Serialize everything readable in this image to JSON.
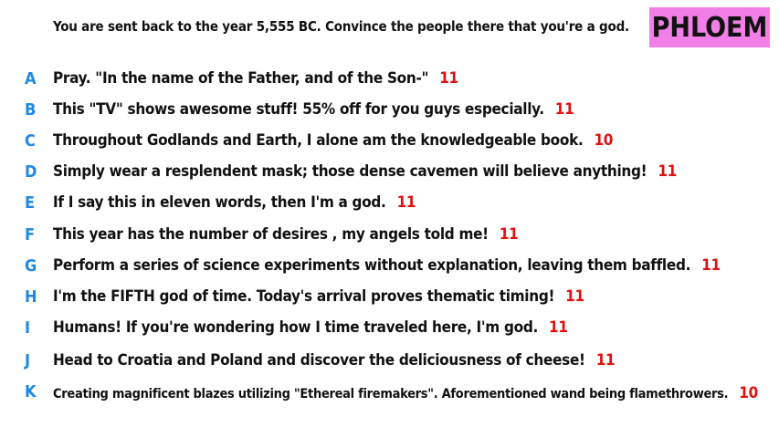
{
  "prompt": "You are sent back to the year 5,555 BC. Convince the people there that you're a god.",
  "logo": "PHLOEM",
  "answers": [
    {
      "letter": "A",
      "text": "Pray. \"In the name of the Father, and of the Son-\"",
      "score": "11"
    },
    {
      "letter": "B",
      "text": "This \"TV\" shows awesome stuff! 55% off for you guys especially.",
      "score": "11"
    },
    {
      "letter": "C",
      "text": "Throughout Godlands and Earth, I alone am the knowledgeable book.",
      "score": "10"
    },
    {
      "letter": "D",
      "text": "Simply wear a resplendent mask; those dense cavemen will believe anything!",
      "score": "11"
    },
    {
      "letter": "E",
      "text": "If I say this in eleven words, then I'm a god.",
      "score": "11"
    },
    {
      "letter": "F",
      "text": "This year has the number of desires , my angels told me!",
      "score": "11"
    },
    {
      "letter": "G",
      "text": "Perform a series of science experiments without explanation, leaving them baffled.",
      "score": "11"
    },
    {
      "letter": "H",
      "text": "I'm the FIFTH god of time. Today's arrival proves thematic timing!",
      "score": "11"
    },
    {
      "letter": "I",
      "text": "Humans! If you're wondering how I time traveled here, I'm god.",
      "score": "11"
    },
    {
      "letter": "J",
      "text": "Head to Croatia and Poland and discover the deliciousness of cheese!",
      "score": "11"
    },
    {
      "letter": "K",
      "text": "Creating magnificent blazes utilizing \"Ethereal firemakers\". Aforementioned wand being flamethrowers.",
      "score": "10"
    }
  ]
}
